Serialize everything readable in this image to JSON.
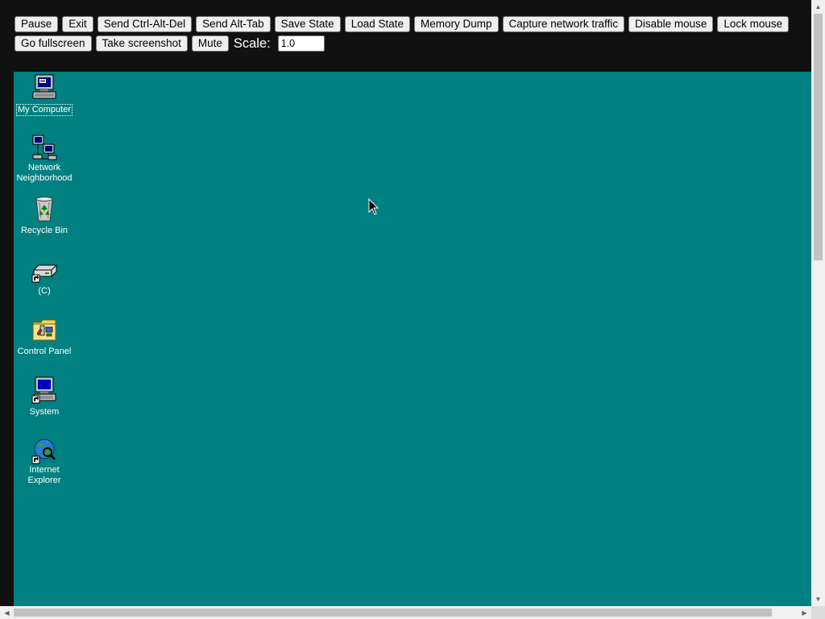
{
  "toolbar": {
    "pause": "Pause",
    "exit": "Exit",
    "send_ctrl_alt_del": "Send Ctrl-Alt-Del",
    "send_alt_tab": "Send Alt-Tab",
    "save_state": "Save State",
    "load_state": "Load State",
    "memory_dump": "Memory Dump",
    "capture_network": "Capture network traffic",
    "disable_mouse": "Disable mouse",
    "lock_mouse": "Lock mouse",
    "go_fullscreen": "Go fullscreen",
    "take_screenshot": "Take screenshot",
    "mute": "Mute",
    "scale_label": "Scale:",
    "scale_value": "1.0"
  },
  "desktop": {
    "background_color": "#008080",
    "icons": [
      {
        "label": "My Computer",
        "icon": "my-computer-icon",
        "selected": true
      },
      {
        "label": "Network Neighborhood",
        "icon": "network-neighborhood-icon"
      },
      {
        "label": "Recycle Bin",
        "icon": "recycle-bin-icon"
      },
      {
        "label": "(C)",
        "icon": "drive-shortcut-icon"
      },
      {
        "label": "Control Panel",
        "icon": "control-panel-icon"
      },
      {
        "label": "System",
        "icon": "system-icon"
      },
      {
        "label": "Internet Explorer",
        "icon": "internet-explorer-icon"
      }
    ]
  }
}
